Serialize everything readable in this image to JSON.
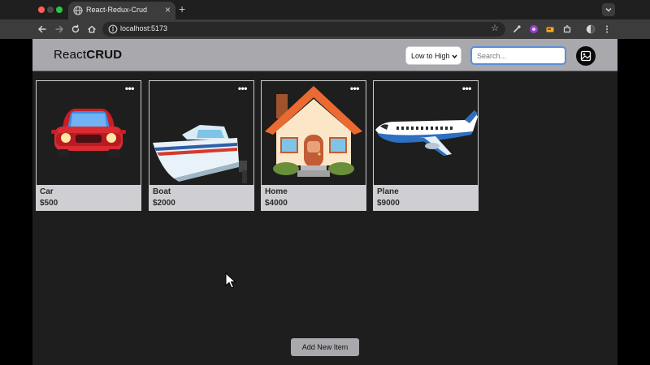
{
  "browser": {
    "tab_title": "React-Redux-Crud",
    "url": "localhost:5173"
  },
  "header": {
    "logo_part1": "React",
    "logo_part2": "CRUD",
    "sort_selected": "Low to High",
    "search_placeholder": "Search...",
    "search_value": ""
  },
  "cards": [
    {
      "name": "Car",
      "price": "$500",
      "image": "car-emoji"
    },
    {
      "name": "Boat",
      "price": "$2000",
      "image": "boat-emoji"
    },
    {
      "name": "Home",
      "price": "$4000",
      "image": "house-emoji"
    },
    {
      "name": "Plane",
      "price": "$9000",
      "image": "airplane-emoji"
    }
  ],
  "card_menu_glyph": "•••",
  "footer": {
    "add_button_label": "Add New Item"
  },
  "colors": {
    "header_bg": "#a9a8ad",
    "page_bg": "#1e1e1e",
    "card_info_bg": "#cfcfd3",
    "search_focus": "#5a8fd8"
  }
}
